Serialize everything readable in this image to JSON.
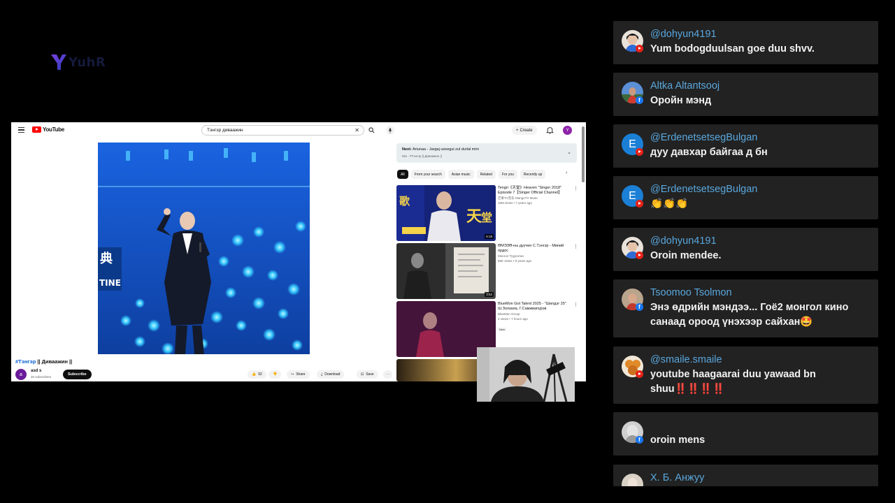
{
  "stream_logo": {
    "text": "YuhR"
  },
  "browser": {
    "header": {
      "logo_text": "YouTube",
      "search_query": "Тэнгэр диваажин",
      "create_label": "Create",
      "account_initial": "Y"
    },
    "video": {
      "caption_tag": "#Тэнгэр",
      "caption_rest": " || Диваажин ||",
      "channel_initial": "a",
      "channel_name": "asd s",
      "subscribers": "30 subscribers",
      "subscribe_label": "Subscribe",
      "likes": "92",
      "share_label": "Share",
      "download_label": "Download",
      "save_label": "Save"
    },
    "next_up": {
      "label": "Next:",
      "title": "Ariunaa - Jargaj uzeegui zul durlal mini",
      "playlist": "Mix - #Тэнгэр || Диваажин ||"
    },
    "chips": [
      "All",
      "From your search",
      "Asian music",
      "Related",
      "For you",
      "Recently up"
    ],
    "recommendations": [
      {
        "title": "Tengri《天堂》Heaven \"Singer 2018\" Episode 7【Singer Official Channel】",
        "channel": "芒果TV音乐 MangoTV Music",
        "stats": "16M views • 7 years ago",
        "duration": "6:18",
        "badge": ""
      },
      {
        "title": "ӨМЭЗӨ-ны дуучин С.Тэнгэр - Миний ордос",
        "channel": "Монгол Туургатан",
        "stats": "86K views • 9 years ago",
        "duration": "3:52",
        "badge": ""
      },
      {
        "title": "BlueMon Got Talent 2025 - \"Шилдэг 25\" Ш.Золзаяа, Г.Самжвапурэв",
        "channel": "BlueMon Group",
        "stats": "4 views • 7 hours ago",
        "duration": "",
        "badge": "New"
      }
    ]
  },
  "chat": [
    {
      "user": "@dohyun4191",
      "message": "Yum bodogduulsan goe duu shvv.",
      "platform": "youtube",
      "avatar": "photo"
    },
    {
      "user": "Altka Altantsooj",
      "message": "Оройн мэнд",
      "platform": "facebook",
      "avatar": "photo"
    },
    {
      "user": "@ErdenetsetsegBulgan",
      "message": "дуу давхар байгаа д бн",
      "platform": "youtube",
      "avatar": "E"
    },
    {
      "user": "@ErdenetsetsegBulgan",
      "message": "👏👏👏",
      "platform": "youtube",
      "avatar": "E"
    },
    {
      "user": "@dohyun4191",
      "message": "Oroin mendee.",
      "platform": "youtube",
      "avatar": "photo"
    },
    {
      "user": "Tsoomoo Tsolmon",
      "message": "Энэ өдрийн мэндээ... Гоё2 монгол кино санаад ороод үнэхээр сайхан🤩",
      "platform": "facebook",
      "avatar": "photo"
    },
    {
      "user": "@smaile.smaile",
      "message": "youtube haagaarai duu yawaad bn shuu‼️‼️‼️‼️",
      "platform": "youtube",
      "avatar": "photo"
    },
    {
      "user": "",
      "message": "oroin mens",
      "platform": "facebook",
      "avatar": "photo"
    },
    {
      "user": "Х. Б. Анжуу",
      "message": "",
      "platform": "facebook",
      "avatar": "photo"
    }
  ]
}
